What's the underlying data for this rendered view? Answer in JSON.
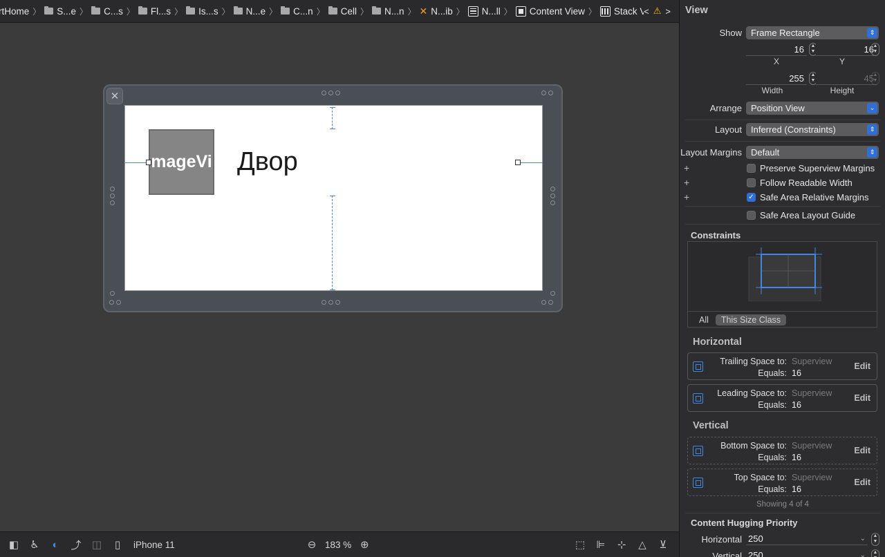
{
  "breadcrumb": {
    "items": [
      {
        "label": "rtHome",
        "icon": "none"
      },
      {
        "label": "S...e",
        "icon": "folder-icon"
      },
      {
        "label": "C...s",
        "icon": "folder-icon"
      },
      {
        "label": "Fl...s",
        "icon": "folder-icon"
      },
      {
        "label": "Is...s",
        "icon": "folder-icon"
      },
      {
        "label": "N...e",
        "icon": "folder-icon"
      },
      {
        "label": "C...n",
        "icon": "folder-icon"
      },
      {
        "label": "Cell",
        "icon": "folder-icon"
      },
      {
        "label": "N...n",
        "icon": "folder-icon"
      },
      {
        "label": "N...ib",
        "icon": "xib-icon"
      },
      {
        "label": "N...ll",
        "icon": "table-cell-icon"
      },
      {
        "label": "Content View",
        "icon": "view-icon"
      },
      {
        "label": "Stack View",
        "icon": "stack-view-icon"
      }
    ],
    "prev": "<",
    "next": ">",
    "warning": "⚠"
  },
  "canvas": {
    "image_view_label": "mageVi",
    "cell_title": "Двор"
  },
  "bottombar": {
    "device": "iPhone 11",
    "zoom_out": "⊖",
    "zoom": "183 %",
    "zoom_in": "⊕"
  },
  "inspector": {
    "title": "View",
    "show": {
      "label": "Show",
      "value": "Frame Rectangle"
    },
    "x": {
      "value": "16",
      "label": "X"
    },
    "y": {
      "value": "16",
      "label": "Y"
    },
    "width": {
      "value": "255",
      "label": "Width"
    },
    "height": {
      "value": "45",
      "label": "Height"
    },
    "arrange": {
      "label": "Arrange",
      "value": "Position View"
    },
    "layout": {
      "label": "Layout",
      "value": "Inferred (Constraints)"
    },
    "layout_margins": {
      "label": "Layout Margins",
      "value": "Default"
    },
    "checkboxes": [
      {
        "label": "Preserve Superview Margins",
        "checked": false
      },
      {
        "label": "Follow Readable Width",
        "checked": false
      },
      {
        "label": "Safe Area Relative Margins",
        "checked": true
      },
      {
        "label": "Safe Area Layout Guide",
        "checked": false
      }
    ],
    "constraints_title": "Constraints",
    "seg_all": "All",
    "seg_size_class": "This Size Class",
    "horizontal_title": "Horizontal",
    "vertical_title": "Vertical",
    "constraints": [
      {
        "label": "Trailing Space to:",
        "target": "Superview",
        "equals_label": "Equals:",
        "equals": "16",
        "edit": "Edit"
      },
      {
        "label": "Leading Space to:",
        "target": "Superview",
        "equals_label": "Equals:",
        "equals": "16",
        "edit": "Edit"
      },
      {
        "label": "Bottom Space to:",
        "target": "Superview",
        "equals_label": "Equals:",
        "equals": "16",
        "edit": "Edit"
      },
      {
        "label": "Top Space to:",
        "target": "Superview",
        "equals_label": "Equals:",
        "equals": "16",
        "edit": "Edit"
      }
    ],
    "showing": "Showing 4 of 4",
    "hugging_title": "Content Hugging Priority",
    "hug_horizontal": {
      "label": "Horizontal",
      "value": "250"
    },
    "hug_vertical": {
      "label": "Vertical",
      "value": "250"
    }
  }
}
